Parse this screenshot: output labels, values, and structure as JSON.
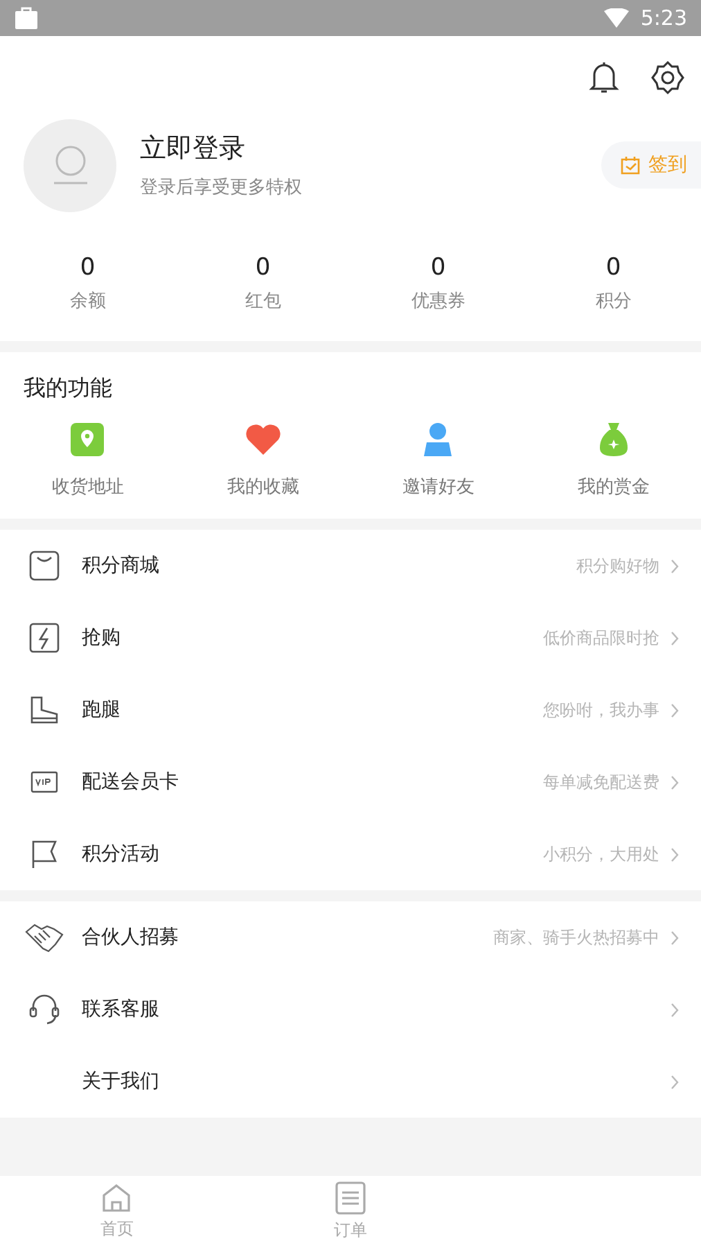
{
  "status_bar": {
    "time": "5:23"
  },
  "profile": {
    "title": "立即登录",
    "subtitle": "登录后享受更多特权",
    "checkin_button": "签到"
  },
  "stats": [
    {
      "value": "0",
      "label": "余额"
    },
    {
      "value": "0",
      "label": "红包"
    },
    {
      "value": "0",
      "label": "优惠券"
    },
    {
      "value": "0",
      "label": "积分"
    }
  ],
  "functions": {
    "title": "我的功能",
    "items": [
      {
        "label": "收货地址"
      },
      {
        "label": "我的收藏"
      },
      {
        "label": "邀请好友"
      },
      {
        "label": "我的赏金"
      }
    ]
  },
  "menu_groups": [
    [
      {
        "label": "积分商城",
        "hint": "积分购好物"
      },
      {
        "label": "抢购",
        "hint": "低价商品限时抢"
      },
      {
        "label": "跑腿",
        "hint": "您吩咐，我办事"
      },
      {
        "label": "配送会员卡",
        "hint": "每单减免配送费"
      },
      {
        "label": "积分活动",
        "hint": "小积分，大用处"
      }
    ],
    [
      {
        "label": "合伙人招募",
        "hint": "商家、骑手火热招募中"
      },
      {
        "label": "联系客服"
      },
      {
        "label": "关于我们"
      }
    ]
  ],
  "bottom_nav": [
    {
      "label": "首页",
      "selected": false
    },
    {
      "label": "订单",
      "selected": false
    }
  ]
}
